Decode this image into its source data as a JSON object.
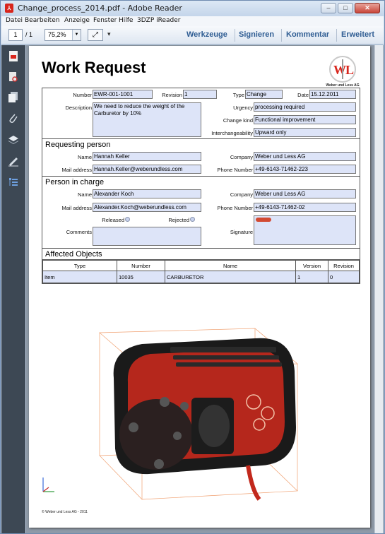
{
  "window": {
    "title": "Change_process_2014.pdf - Adobe Reader",
    "buttons": {
      "minimize": "–",
      "maximize": "□",
      "close": "✕"
    }
  },
  "menu": {
    "items": [
      "Datei",
      "Bearbeiten",
      "Anzeige",
      "Fenster",
      "Hilfe",
      "3DZP iReader"
    ]
  },
  "toolbar": {
    "page_current": "1",
    "page_total": "/ 1",
    "zoom": "75,2%",
    "buttons": [
      "Werkzeuge",
      "Signieren",
      "Kommentar",
      "Erweitert"
    ]
  },
  "sidebar": {
    "icons": [
      "pdf-icon",
      "search-page-icon",
      "pages-icon",
      "attachment-icon",
      "layers-icon",
      "sign-icon",
      "model-tree-icon"
    ]
  },
  "document": {
    "title": "Work Request",
    "logo_text": "Weber und Less AG",
    "general": {
      "number_label": "Number",
      "number": "EWR-001-1001",
      "revision_label": "Revision",
      "revision": "1",
      "type_label": "Type",
      "type": "Change",
      "date_label": "Date",
      "date": "15.12.2011",
      "description_label": "Description",
      "description": "We need to reduce the weight of the Carburetor by 10%",
      "urgency_label": "Urgency",
      "urgency": "processing required",
      "change_kind_label": "Change kind",
      "change_kind": "Functional improvement",
      "interchangeability_label": "Interchangeability",
      "interchangeability": "Upward only"
    },
    "requesting": {
      "heading": "Requesting person",
      "name_label": "Name",
      "name": "Hannah Keller",
      "company_label": "Company",
      "company": "Weber und Less AG",
      "mail_label": "Mail address",
      "mail": "Hannah.Keller@weberundless.com",
      "phone_label": "Phone Number",
      "phone": "+49-6143-71462-223"
    },
    "charge": {
      "heading": "Person in charge",
      "name_label": "Name",
      "name": "Alexander Koch",
      "company_label": "Company",
      "company": "Weber und Less AG",
      "mail_label": "Mail address",
      "mail": "Alexander.Koch@weberundless.com",
      "phone_label": "Phone Number",
      "phone": "+49-6143-71462-02",
      "released_label": "Released",
      "rejected_label": "Rejected",
      "comments_label": "Comments",
      "signature_label": "Signature"
    },
    "affected": {
      "heading": "Affected Objects",
      "columns": [
        "Type",
        "Number",
        "Name",
        "Version",
        "Revision"
      ],
      "rows": [
        [
          "Item",
          "10035",
          "CARBURETOR",
          "1",
          "0"
        ]
      ]
    },
    "footer": "© Weber und Less AG - 2011"
  }
}
